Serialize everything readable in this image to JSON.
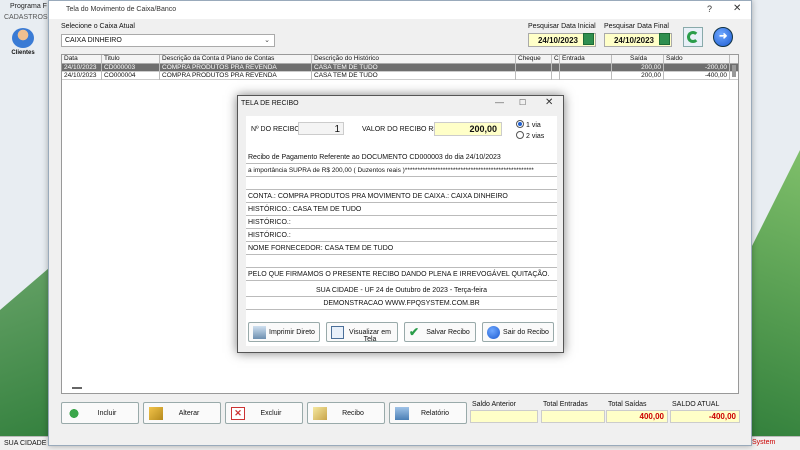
{
  "background_app": {
    "title": "Programa F",
    "menu": "CADASTROS",
    "clientes_label": "Clientes",
    "statusbar": "SUA CIDADE - UF",
    "system_label": "System"
  },
  "main": {
    "title": "Tela do Movimento de Caixa/Banco",
    "help": "?",
    "close": "✕",
    "caixa_label": "Selecione o Caixa Atual",
    "caixa_value": "CAIXA DINHEIRO",
    "data_ini_label": "Pesquisar Data Inicial",
    "data_ini": "24/10/2023",
    "data_fim_label": "Pesquisar Data Final",
    "data_fim": "24/10/2023"
  },
  "grid": {
    "columns": [
      "Data",
      "Titulo",
      "Descrição da Conta d Plano de Contas",
      "Descrição do Histórico",
      "Cheque",
      "C",
      "Entrada",
      "Saída",
      "Saldo"
    ],
    "rows": [
      [
        "24/10/2023",
        "CD000003",
        "COMPRA PRODUTOS PRA REVENDA",
        "CASA TEM DE TUDO",
        "",
        "",
        "",
        "200,00",
        "-200,00"
      ],
      [
        "24/10/2023",
        "CO000004",
        "COMPRA PRODUTOS PRA REVENDA",
        "CASA TEM DE TUDO",
        "",
        "",
        "",
        "200,00",
        "-400,00"
      ]
    ]
  },
  "bottom": {
    "incluir": "Incluir",
    "alterar": "Alterar",
    "excluir": "Excluir",
    "recibo": "Recibo",
    "relatorio": "Relatório",
    "saldo_anterior_label": "Saldo Anterior",
    "saldo_anterior": "",
    "total_entradas_label": "Total Entradas",
    "total_entradas": "",
    "total_saidas_label": "Total Saídas",
    "total_saidas": "400,00",
    "saldo_atual_label": "SALDO ATUAL",
    "saldo_atual": "-400,00"
  },
  "modal": {
    "title": "TELA DE RECIBO",
    "min": "—",
    "max": "☐",
    "close": "✕",
    "nro_label": "Nº DO RECIBO",
    "nro": "1",
    "valor_label": "VALOR DO RECIBO R$",
    "valor": "200,00",
    "via1": "1 via",
    "via2": "2 vias",
    "lines": {
      "l1": "Recibo de Pagamento Referente ao DOCUMENTO CD000003    do dia 24/10/2023",
      "l2": "a importância SUPRA de R$      200,00 ( Duzentos reais )***************************************************",
      "l3": "",
      "l4": "CONTA.: COMPRA PRODUTOS PRA  MOVIMENTO DE CAIXA.: CAIXA DINHEIRO",
      "l5": "HISTÓRICO.: CASA TEM DE TUDO",
      "l6": "HISTÓRICO.:",
      "l7": "HISTÓRICO.:",
      "l8": "NOME FORNECEDOR: CASA TEM DE TUDO",
      "l9": "",
      "l10": "PELO QUE FIRMAMOS O PRESENTE RECIBO DANDO PLENA E IRREVOGÁVEL QUITAÇÃO.",
      "l11": "SUA CIDADE - UF 24 de Outubro de 2023 - Terça-feira",
      "l12": "DEMONSTRACAO WWW.FPQSYSTEM.COM.BR"
    },
    "btn_imprimir": "Imprimir Direto",
    "btn_visualizar": "Visualizar em Tela",
    "btn_salvar": "Salvar Recibo",
    "btn_sair": "Sair do Recibo"
  },
  "colors": {
    "field_yellow": "#ffffc8",
    "selected_row": "#6e6e6e",
    "negative_red": "#cc0000"
  }
}
